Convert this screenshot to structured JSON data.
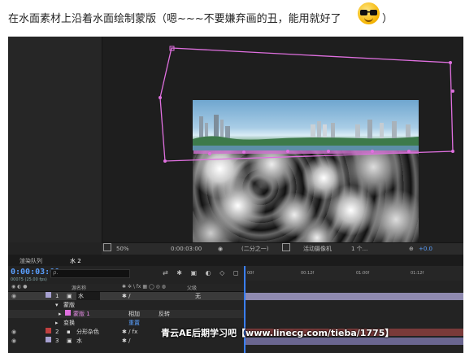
{
  "caption": {
    "text": "在水面素材上沿着水面绘制蒙版（嗯~~~不要嫌弃画的丑，能用就好了",
    "close_paren": "）",
    "emoji": "cool-sunglasses-emoji"
  },
  "viewer": {
    "zoom": "50%",
    "timecode": "0:00:03:00",
    "resolution": "(二分之一)",
    "camera": "活动摄像机",
    "views": "1 个...",
    "exposure": "+0.0"
  },
  "timeline": {
    "tab_render_queue": "渲染队列",
    "tab_comp": "水 2",
    "current_time": "0:00:03:00",
    "frames_text": "00075 (25.00 fps)",
    "search_placeholder": "ρ.",
    "ruler_ticks": [
      "00f",
      "00:12f",
      "01:00f",
      "01:12f"
    ],
    "col_layer_name": "源名称",
    "col_parent": "父级",
    "layers": [
      {
        "num": "1",
        "name": "水",
        "parent": "无"
      },
      {
        "name": "蒙版"
      },
      {
        "name": "蒙版 1",
        "mode": "相加",
        "invert": "反转"
      },
      {
        "name": "变换",
        "reset": "重置"
      },
      {
        "num": "2",
        "name": "分形杂色"
      },
      {
        "num": "3",
        "name": "水"
      }
    ]
  },
  "watermark": "青云AE后期学习吧【www.linecg.com/tieba/1775】",
  "colors": {
    "mask": "#e070e0",
    "timecode": "#5aa0ff",
    "layer1": "#a6a0d0",
    "layer2": "#c04040",
    "layer3": "#a6a0d0"
  }
}
